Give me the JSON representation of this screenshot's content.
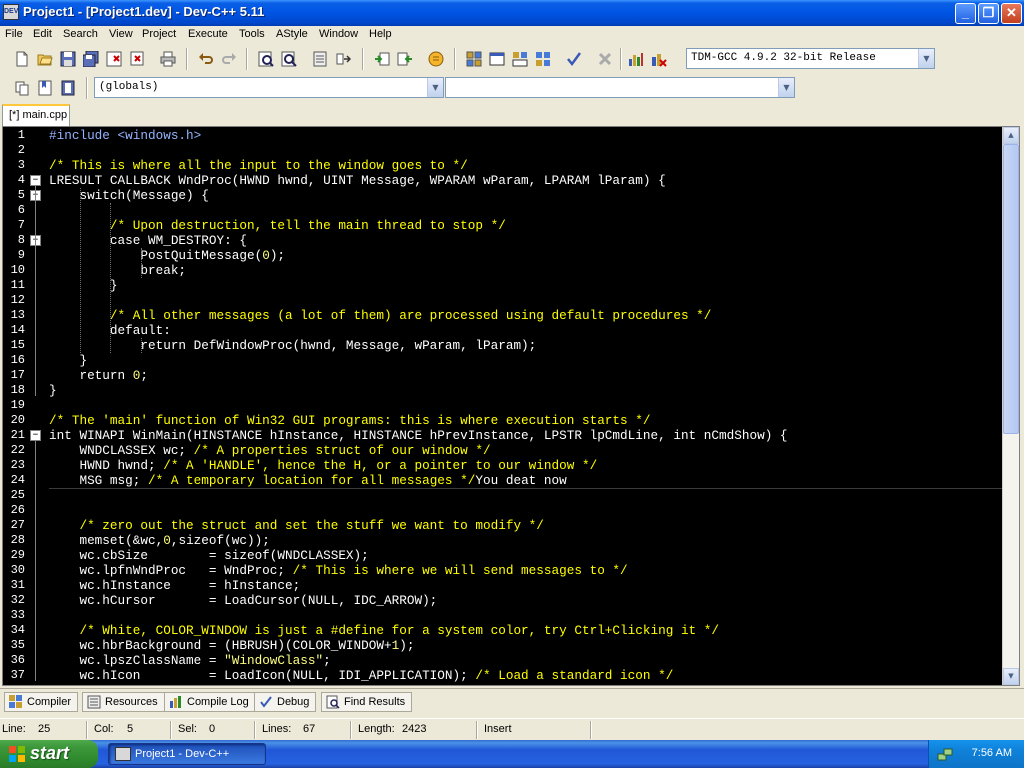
{
  "window": {
    "title": "Project1 - [Project1.dev] - Dev-C++ 5.11",
    "icon_label": "DEV"
  },
  "menu": [
    "File",
    "Edit",
    "Search",
    "View",
    "Project",
    "Execute",
    "Tools",
    "AStyle",
    "Window",
    "Help"
  ],
  "toolbar": {
    "compiler_select": "TDM-GCC 4.9.2 32-bit Release",
    "scope_select": "(globals)",
    "function_select": "",
    "buttons": [
      "new-icon",
      "open-icon",
      "save-icon",
      "save-all-icon",
      "close-icon",
      "print-icon",
      "undo-icon",
      "redo-icon",
      "find-icon",
      "replace-icon",
      "goto-icon",
      "bookmark-icon",
      "indent-icon",
      "unindent-icon",
      "toggle-comment-icon",
      "compile-icon",
      "run-icon",
      "compile-run-icon",
      "rebuild-icon",
      "syntax-check-icon",
      "stop-icon",
      "chart-icon",
      "profile-icon"
    ]
  },
  "tabs": [
    {
      "label": "[*] main.cpp"
    }
  ],
  "editor": {
    "lines": [
      {
        "n": "1",
        "t": "#include <windows.h>",
        "cls": "pre"
      },
      {
        "n": "2",
        "t": "",
        "cls": "id"
      },
      {
        "n": "3",
        "t": "/* This is where all the input to the window goes to */",
        "cls": "cm"
      },
      {
        "n": "4",
        "t": "LRESULT CALLBACK WndProc(HWND hwnd, UINT Message, WPARAM wParam, LPARAM lParam) {",
        "cls": "id"
      },
      {
        "n": "5",
        "t": "    switch(Message) {",
        "cls": "id"
      },
      {
        "n": "6",
        "t": "",
        "cls": "id"
      },
      {
        "n": "7",
        "t": "        /* Upon destruction, tell the main thread to stop */",
        "cls": "cm"
      },
      {
        "n": "8",
        "t": "        case WM_DESTROY: {",
        "cls": "id"
      },
      {
        "n": "9",
        "t": "            PostQuitMessage(0);",
        "cls": "id"
      },
      {
        "n": "10",
        "t": "            break;",
        "cls": "id"
      },
      {
        "n": "11",
        "t": "        }",
        "cls": "id"
      },
      {
        "n": "12",
        "t": "",
        "cls": "id"
      },
      {
        "n": "13",
        "t": "        /* All other messages (a lot of them) are processed using default procedures */",
        "cls": "cm"
      },
      {
        "n": "14",
        "t": "        default:",
        "cls": "id"
      },
      {
        "n": "15",
        "t": "            return DefWindowProc(hwnd, Message, wParam, lParam);",
        "cls": "id"
      },
      {
        "n": "16",
        "t": "    }",
        "cls": "id"
      },
      {
        "n": "17",
        "t": "    return 0;",
        "cls": "id"
      },
      {
        "n": "18",
        "t": "}",
        "cls": "id"
      },
      {
        "n": "19",
        "t": "",
        "cls": "id"
      },
      {
        "n": "20",
        "t": "/* The 'main' function of Win32 GUI programs: this is where execution starts */",
        "cls": "cm"
      },
      {
        "n": "21",
        "t": "int WINAPI WinMain(HINSTANCE hInstance, HINSTANCE hPrevInstance, LPSTR lpCmdLine, int nCmdShow) {",
        "cls": "id"
      },
      {
        "n": "22",
        "t": "    WNDCLASSEX wc; /* A properties struct of our window */",
        "cls": "id"
      },
      {
        "n": "23",
        "t": "    HWND hwnd; /* A 'HANDLE', hence the H, or a pointer to our window */",
        "cls": "id"
      },
      {
        "n": "24",
        "t": "    MSG msg; /* A temporary location for all messages */You deat now",
        "cls": "id"
      },
      {
        "n": "25",
        "t": "",
        "cls": "id"
      },
      {
        "n": "26",
        "t": "",
        "cls": "id"
      },
      {
        "n": "27",
        "t": "    /* zero out the struct and set the stuff we want to modify */",
        "cls": "cm"
      },
      {
        "n": "28",
        "t": "    memset(&wc,0,sizeof(wc));",
        "cls": "id"
      },
      {
        "n": "29",
        "t": "    wc.cbSize        = sizeof(WNDCLASSEX);",
        "cls": "id"
      },
      {
        "n": "30",
        "t": "    wc.lpfnWndProc   = WndProc; /* This is where we will send messages to */",
        "cls": "id"
      },
      {
        "n": "31",
        "t": "    wc.hInstance     = hInstance;",
        "cls": "id"
      },
      {
        "n": "32",
        "t": "    wc.hCursor       = LoadCursor(NULL, IDC_ARROW);",
        "cls": "id"
      },
      {
        "n": "33",
        "t": "",
        "cls": "id"
      },
      {
        "n": "34",
        "t": "    /* White, COLOR_WINDOW is just a #define for a system color, try Ctrl+Clicking it */",
        "cls": "cm"
      },
      {
        "n": "35",
        "t": "    wc.hbrBackground = (HBRUSH)(COLOR_WINDOW+1);",
        "cls": "id"
      },
      {
        "n": "36",
        "t": "    wc.lpszClassName = \"WindowClass\";",
        "cls": "id"
      },
      {
        "n": "37",
        "t": "    wc.hIcon         = LoadIcon(NULL, IDI_APPLICATION); /* Load a standard icon */",
        "cls": "id"
      }
    ],
    "fold_lines": [
      "4",
      "5",
      "8",
      "21"
    ],
    "current_line": "25"
  },
  "bottom_tabs": [
    "Compiler",
    "Resources",
    "Compile Log",
    "Debug",
    "Find Results"
  ],
  "status": {
    "line_label": "Line:",
    "line_value": "25",
    "col_label": "Col:",
    "col_value": "5",
    "sel_label": "Sel:",
    "sel_value": "0",
    "lines_label": "Lines:",
    "lines_value": "67",
    "length_label": "Length:",
    "length_value": "2423",
    "mode": "Insert"
  },
  "taskbar": {
    "start_label": "start",
    "task_label": "Project1 - Dev-C++",
    "clock": "7:56 AM"
  }
}
